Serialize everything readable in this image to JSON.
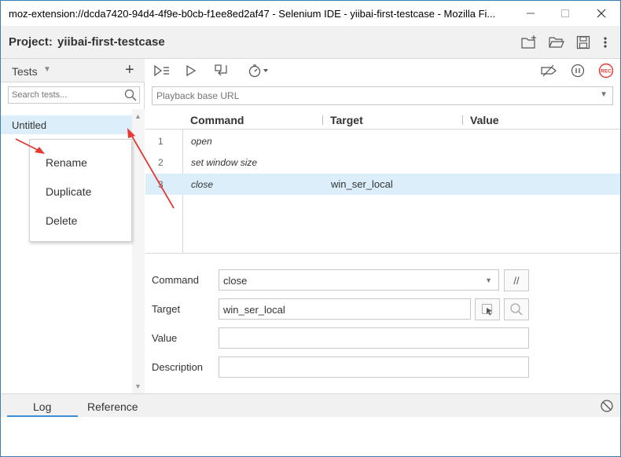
{
  "window": {
    "title": "moz-extension://dcda7420-94d4-4f9e-b0cb-f1ee8ed2af47 - Selenium IDE - yiibai-first-testcase - Mozilla Fi...",
    "controls": [
      "minimize-icon",
      "maximize-icon",
      "close-icon"
    ]
  },
  "project": {
    "label": "Project:",
    "name": "yiibai-first-testcase",
    "actions": [
      "new-project-icon",
      "open-folder-icon",
      "save-icon",
      "more-vertical-icon"
    ]
  },
  "sidebar": {
    "header": "Tests",
    "add_label": "+",
    "search_placeholder": "Search tests...",
    "tests": [
      {
        "name": "Untitled",
        "selected": true
      }
    ]
  },
  "context_menu": {
    "items": [
      "Rename",
      "Duplicate",
      "Delete"
    ]
  },
  "toolbar": {
    "left_icons": [
      "run-all-tests-icon",
      "run-current-test-icon",
      "step-icon",
      "speed-timer-icon"
    ],
    "right_icons": [
      "disable-breakpoints-icon",
      "pause-icon"
    ],
    "record_label": "REC"
  },
  "base_url": {
    "placeholder": "Playback base URL"
  },
  "table": {
    "headers": {
      "command": "Command",
      "target": "Target",
      "value": "Value"
    },
    "rows": [
      {
        "num": "1",
        "command": "open",
        "target": "",
        "value": "",
        "selected": false
      },
      {
        "num": "2",
        "command": "set window size",
        "target": "",
        "value": "",
        "selected": false
      },
      {
        "num": "3",
        "command": "close",
        "target": "win_ser_local",
        "value": "",
        "selected": true
      }
    ]
  },
  "editor": {
    "command_label": "Command",
    "command_value": "close",
    "comment_toggle": "//",
    "target_label": "Target",
    "target_value": "win_ser_local",
    "value_label": "Value",
    "value_value": "",
    "description_label": "Description",
    "description_value": ""
  },
  "bottom": {
    "tabs": [
      "Log",
      "Reference"
    ],
    "active_tab": "Log"
  },
  "colors": {
    "accent": "#3b8dd6",
    "selected_row": "#dceefa",
    "record": "#e53935",
    "annotation_arrow": "#e53935"
  }
}
